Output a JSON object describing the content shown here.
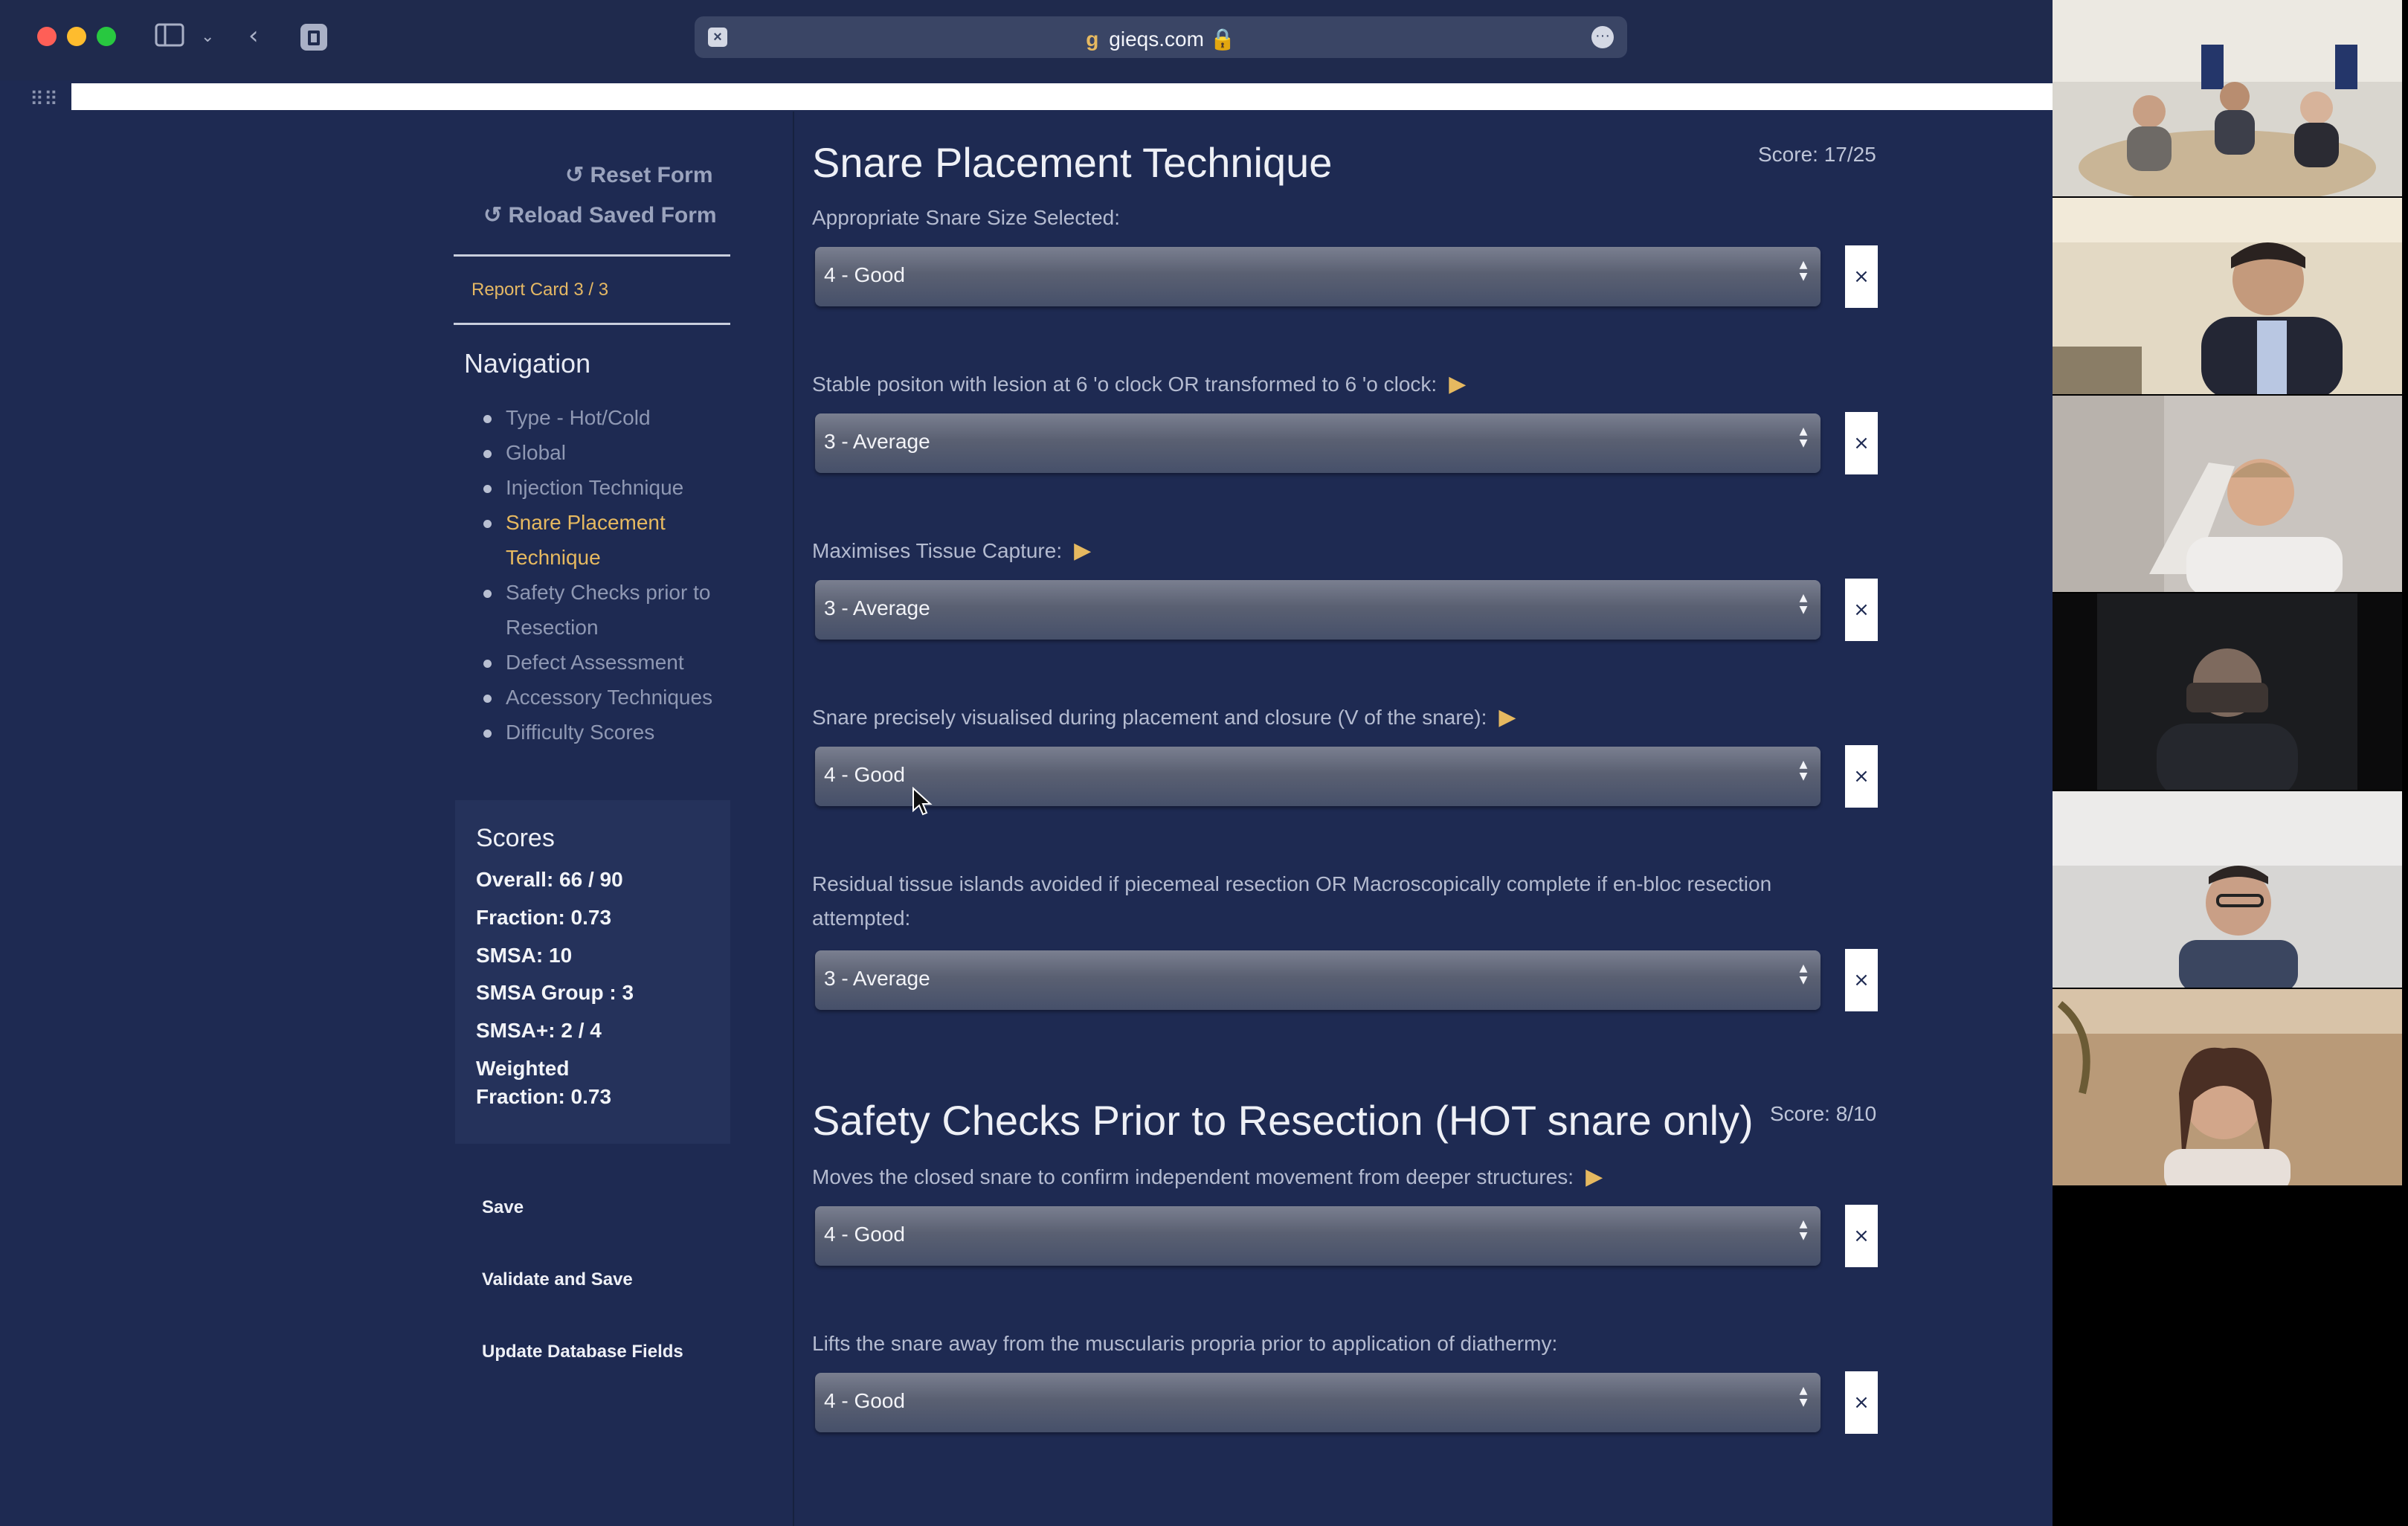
{
  "browser": {
    "url_text": "gieqs.com",
    "lock_icon": "lock-icon",
    "traffic_lights": {
      "close": "#fe5f57",
      "minimize": "#febc2e",
      "maximize": "#28c840"
    }
  },
  "sidebar": {
    "reset_form": "Reset Form",
    "reload_saved_form": "Reload Saved Form",
    "report_card": "Report Card 3 / 3",
    "navigation_heading": "Navigation",
    "nav_items": [
      {
        "label": "Type - Hot/Cold",
        "active": false
      },
      {
        "label": "Global",
        "active": false
      },
      {
        "label": "Injection Technique",
        "active": false
      },
      {
        "label": "Snare Placement Technique",
        "active": true
      },
      {
        "label": "Safety Checks prior to Resection",
        "active": false
      },
      {
        "label": "Defect Assessment",
        "active": false
      },
      {
        "label": "Accessory Techniques",
        "active": false
      },
      {
        "label": "Difficulty Scores",
        "active": false
      }
    ],
    "scores": {
      "heading": "Scores",
      "overall": "Overall: 66 / 90",
      "fraction": "Fraction: 0.73",
      "smsa": "SMSA: 10",
      "smsa_group": "SMSA Group : 3",
      "smsa_plus": "SMSA+: 2 / 4",
      "weighted_line1": "Weighted",
      "weighted_line2": "Fraction: 0.73"
    },
    "actions": {
      "save": "Save",
      "validate_and_save": "Validate and Save",
      "update_database": "Update Database Fields"
    }
  },
  "sections": [
    {
      "title": "Snare Placement Technique",
      "score": "Score: 17/25",
      "questions": [
        {
          "label": "Appropriate Snare Size Selected:",
          "value": "4 - Good",
          "has_video": false
        },
        {
          "label": "Stable positon with lesion at 6 'o clock OR transformed to 6 'o clock:",
          "value": "3 - Average",
          "has_video": true
        },
        {
          "label": "Maximises Tissue Capture:",
          "value": "3 - Average",
          "has_video": true
        },
        {
          "label": "Snare precisely visualised during placement and closure (V of the snare):",
          "value": "4 - Good",
          "has_video": true
        },
        {
          "label": "Residual tissue islands avoided if piecemeal resection OR Macroscopically complete if en-bloc resection attempted:",
          "value": "3 - Average",
          "has_video": false
        }
      ]
    },
    {
      "title": "Safety Checks Prior to Resection (HOT snare only)",
      "score": "Score: 8/10",
      "questions": [
        {
          "label": "Moves the closed snare to confirm independent movement from deeper structures:",
          "value": "4 - Good",
          "has_video": true
        },
        {
          "label": "Lifts the snare away from the muscularis propria prior to application of diathermy:",
          "value": "4 - Good",
          "has_video": false
        }
      ]
    }
  ],
  "clear_symbol": "×",
  "play_symbol": "▶",
  "reset_symbol": "↺"
}
